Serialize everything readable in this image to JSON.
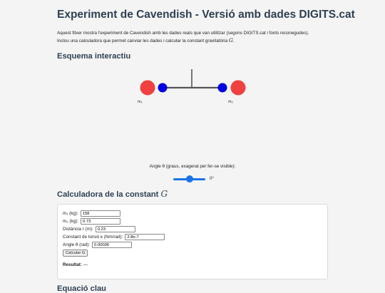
{
  "title": "Experiment de Cavendish - Versió amb dades DIGITS.cat",
  "intro": {
    "line1": "Aquest fitxer mostra l'experiment de Cavendish amb les dades reals que van utilitzar (segons DIGITS.cat i fonts reconegudes).",
    "line2": "Inclou una calculadora que permet canviar les dades i calcular la constant gravitatòria ",
    "g_symbol": "G",
    "line2_end": "."
  },
  "schema": {
    "heading": "Esquema interactiu",
    "label_m1": "m₁",
    "label_m2": "m₂",
    "colors": {
      "large_mass": "#f04040",
      "small_mass": "#0000e0",
      "rod": "#555555"
    }
  },
  "angle": {
    "label": "Angle θ (graus, exagerat per fer-se visible):",
    "value_text": "0°",
    "slider_fraction": 0.5
  },
  "calculator": {
    "heading": "Calculadora de la constant ",
    "g_symbol": "G",
    "fields": {
      "m1": {
        "label": "m₁ (kg):",
        "value": "158"
      },
      "m2": {
        "label": "m₂ (kg):",
        "value": "0.73"
      },
      "r": {
        "label": "Distància r (m):",
        "value": "0.23"
      },
      "kappa": {
        "label": "Constant de torsió κ (Nm/rad):",
        "value": "2.8e-7"
      },
      "theta": {
        "label": "Angle θ (rad):",
        "value": "0.00036"
      }
    },
    "button_label": "Calcular G",
    "result_label": "Resultat:",
    "result_value": "—"
  },
  "next_section_heading": "Equació clau"
}
